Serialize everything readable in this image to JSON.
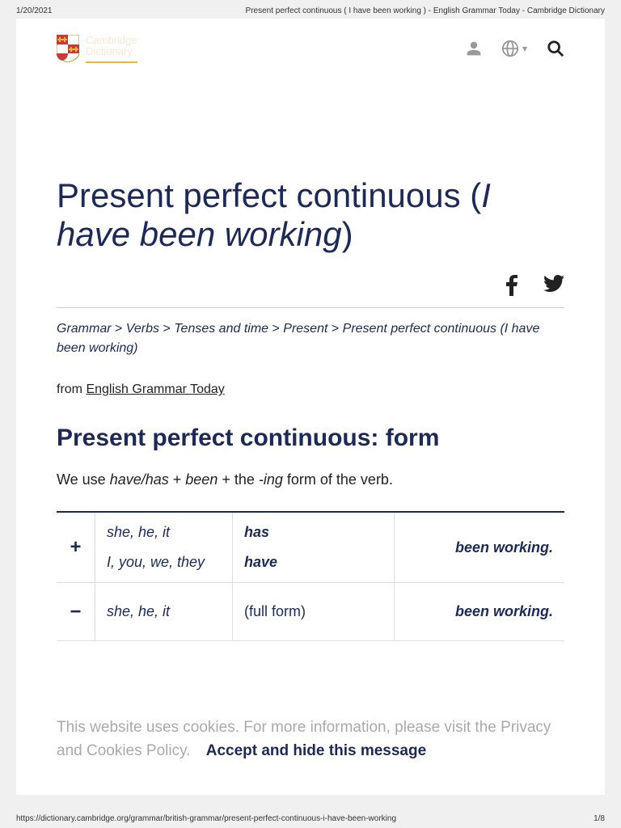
{
  "print": {
    "date": "1/20/2021",
    "title": "Present perfect continuous ( I have been working ) - English Grammar Today - Cambridge Dictionary",
    "url": "https://dictionary.cambridge.org/grammar/british-grammar/present-perfect-continuous-i-have-been-working",
    "page": "1/8"
  },
  "logo": {
    "line1": "Cambridge",
    "line2": "Dictionary"
  },
  "title": {
    "prefix": "Present perfect continuous (",
    "italic": "I have been working",
    "suffix": ")"
  },
  "breadcrumb": {
    "items": [
      "Grammar",
      "Verbs",
      "Tenses and time",
      "Present",
      "Present perfect continuous (I have been working)"
    ],
    "sep": " > "
  },
  "from": {
    "label": "from ",
    "link": "English Grammar Today"
  },
  "section": {
    "heading": "Present perfect continuous: form",
    "usage_pre": "We use ",
    "usage_i1": "have/has",
    "usage_plus1": " + ",
    "usage_i2": "been",
    "usage_plus2": " + the ",
    "usage_i3": "-ing",
    "usage_post": " form of the verb."
  },
  "table": {
    "rows": [
      {
        "sign": "+",
        "pronouns": [
          "she, he, it",
          "I, you, we, they"
        ],
        "aux": [
          "has",
          "have"
        ],
        "aux_style": "bold",
        "verb": "been working."
      },
      {
        "sign": "−",
        "pronouns": [
          "she, he, it"
        ],
        "aux": [
          "(full form)"
        ],
        "aux_style": "plain",
        "verb": "been working."
      }
    ]
  },
  "cookie": {
    "text": "This website uses cookies. For more information, please visit the Privacy and Cookies Policy.",
    "accept": "Accept and hide this message"
  }
}
